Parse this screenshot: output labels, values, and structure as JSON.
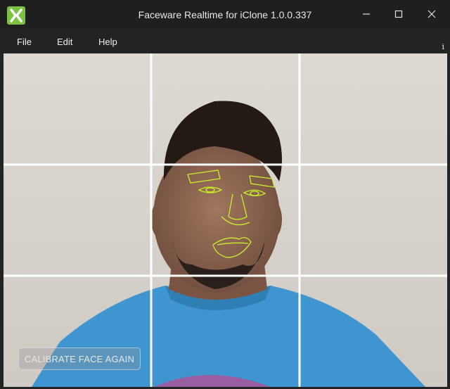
{
  "window": {
    "title": "Faceware Realtime for iClone 1.0.0.337",
    "icons": [
      "app-logo-icon",
      "minimize-icon",
      "maximize-icon",
      "close-icon"
    ]
  },
  "menu": {
    "items": [
      {
        "label": "File"
      },
      {
        "label": "Edit"
      },
      {
        "label": "Help"
      }
    ],
    "info_label": "i"
  },
  "video": {
    "grid": "3x3 rule-of-thirds overlay",
    "tracking_color": "#c8f02a",
    "grid_color": "#ffffff"
  },
  "calibrate_button": {
    "label": "CALIBRATE FACE AGAIN"
  }
}
